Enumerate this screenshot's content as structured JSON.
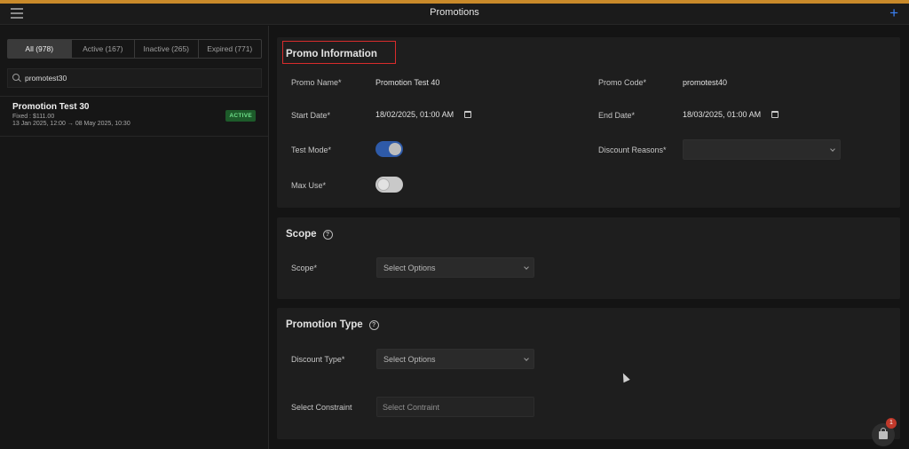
{
  "header": {
    "title": "Promotions"
  },
  "sidebar": {
    "filters": [
      {
        "label": "All (978)"
      },
      {
        "label": "Active (167)"
      },
      {
        "label": "Inactive (265)"
      },
      {
        "label": "Expired (771)"
      }
    ],
    "search": {
      "value": "promotest30"
    },
    "promotions": [
      {
        "name": "Promotion Test 30",
        "type_line": "Fixed : $111.00",
        "dates": "13 Jan 2025, 12:00 → 08 May 2025, 10:30",
        "status": "ACTIVE"
      }
    ]
  },
  "promo_info": {
    "title": "Promo Information",
    "promo_name_label": "Promo Name*",
    "promo_name_value": "Promotion Test 40",
    "promo_code_label": "Promo Code*",
    "promo_code_value": "promotest40",
    "start_date_label": "Start Date*",
    "start_date_value": "18/02/2025, 01:00 AM",
    "end_date_label": "End Date*",
    "end_date_value": "18/03/2025, 01:00 AM",
    "test_mode_label": "Test Mode*",
    "test_mode_on": true,
    "discount_reasons_label": "Discount Reasons*",
    "discount_reasons_value": "",
    "max_use_label": "Max Use*",
    "max_use_on": false
  },
  "scope": {
    "title": "Scope",
    "scope_label": "Scope*",
    "scope_value": "Select Options"
  },
  "promotion_type": {
    "title": "Promotion Type",
    "discount_type_label": "Discount Type*",
    "discount_type_value": "Select Options",
    "constraint_label": "Select Constraint",
    "constraint_placeholder": "Select Contraint"
  },
  "cart": {
    "badge_count": "1"
  },
  "colors": {
    "accent_bar": "#c98a2a",
    "add_button": "#3b82f6",
    "active_badge": "#1d5b2a",
    "highlight": "#d92c2c",
    "toggle_on": "#2e5aa8"
  }
}
